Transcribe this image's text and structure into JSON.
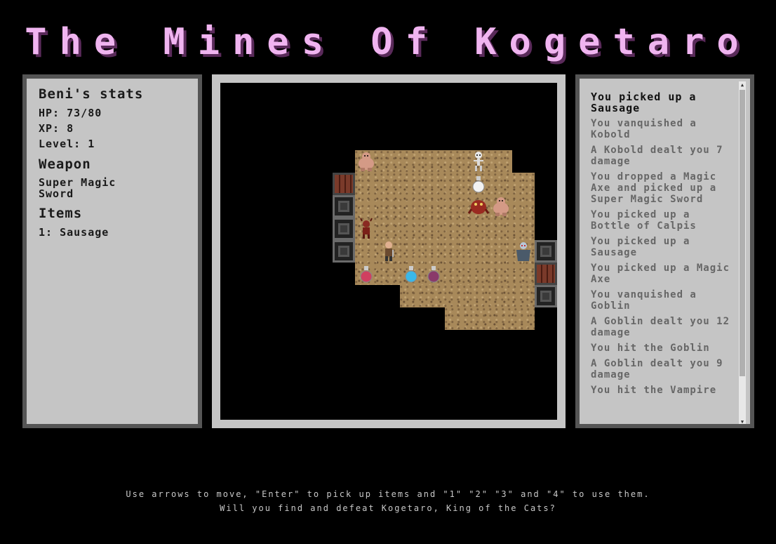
{
  "title": "The Mines Of Kogetaro",
  "stats": {
    "heading": "Beni's stats",
    "hp": "HP: 73/80",
    "xp": "XP: 8",
    "level": "Level: 1",
    "weapon_heading": "Weapon",
    "weapon": "Super Magic Sword",
    "items_heading": "Items",
    "items": [
      "1: Sausage"
    ]
  },
  "log": [
    "You picked up a Sausage",
    "You vanquished a Kobold",
    "A Kobold dealt you 7 damage",
    "You dropped a Magic Axe and picked up a Super Magic Sword",
    "You picked up a Bottle of Calpis",
    "You picked up a Sausage",
    "You picked up a Magic Axe",
    "You vanquished a Goblin",
    "A Goblin dealt you 12 damage",
    "You hit the Goblin",
    "A Goblin dealt you 9 damage",
    "You hit the Vampire"
  ],
  "help": {
    "line1": "Use arrows to move, \"Enter\" to pick up items and \"1\" \"2\" \"3\" and \"4\" to use them.",
    "line2": "Will you find and defeat Kogetaro, King of the Cats?"
  },
  "map_sprites": [
    {
      "name": "ogre-icon"
    },
    {
      "name": "skeleton-icon"
    },
    {
      "name": "white-potion-icon"
    },
    {
      "name": "red-demon-icon"
    },
    {
      "name": "ogre-icon"
    },
    {
      "name": "kobold-icon"
    },
    {
      "name": "player-hero-icon"
    },
    {
      "name": "vampire-icon"
    },
    {
      "name": "red-potion-icon"
    },
    {
      "name": "blue-potion-icon"
    },
    {
      "name": "purple-potion-icon"
    }
  ],
  "colors": {
    "title": "#f0b4f0",
    "panel": "#c5c5c5",
    "floor": "#a8895a"
  }
}
